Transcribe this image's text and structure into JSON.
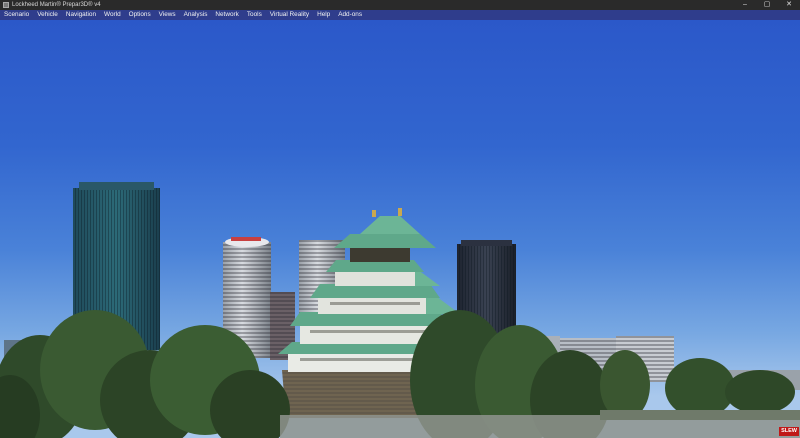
{
  "window": {
    "title": "Lockheed Martin® Prepar3D® v4",
    "controls": {
      "minimize_glyph": "–",
      "maximize_glyph": "▢",
      "close_glyph": "✕"
    }
  },
  "menu": {
    "items": [
      {
        "label": "Scenario"
      },
      {
        "label": "Vehicle"
      },
      {
        "label": "Navigation"
      },
      {
        "label": "World"
      },
      {
        "label": "Options"
      },
      {
        "label": "Views"
      },
      {
        "label": "Analysis"
      },
      {
        "label": "Network"
      },
      {
        "label": "Tools"
      },
      {
        "label": "Virtual Reality"
      },
      {
        "label": "Help"
      },
      {
        "label": "Add-ons"
      }
    ]
  },
  "status": {
    "slew": "SLEW"
  },
  "colors": {
    "menubar": "#2f3d8c",
    "titlebar": "#2a2a2a",
    "sky_top": "#2b58c9",
    "sky_bottom": "#a9c8ec",
    "castle_roof": "#5fa88a",
    "slew_badge": "#c01818"
  }
}
